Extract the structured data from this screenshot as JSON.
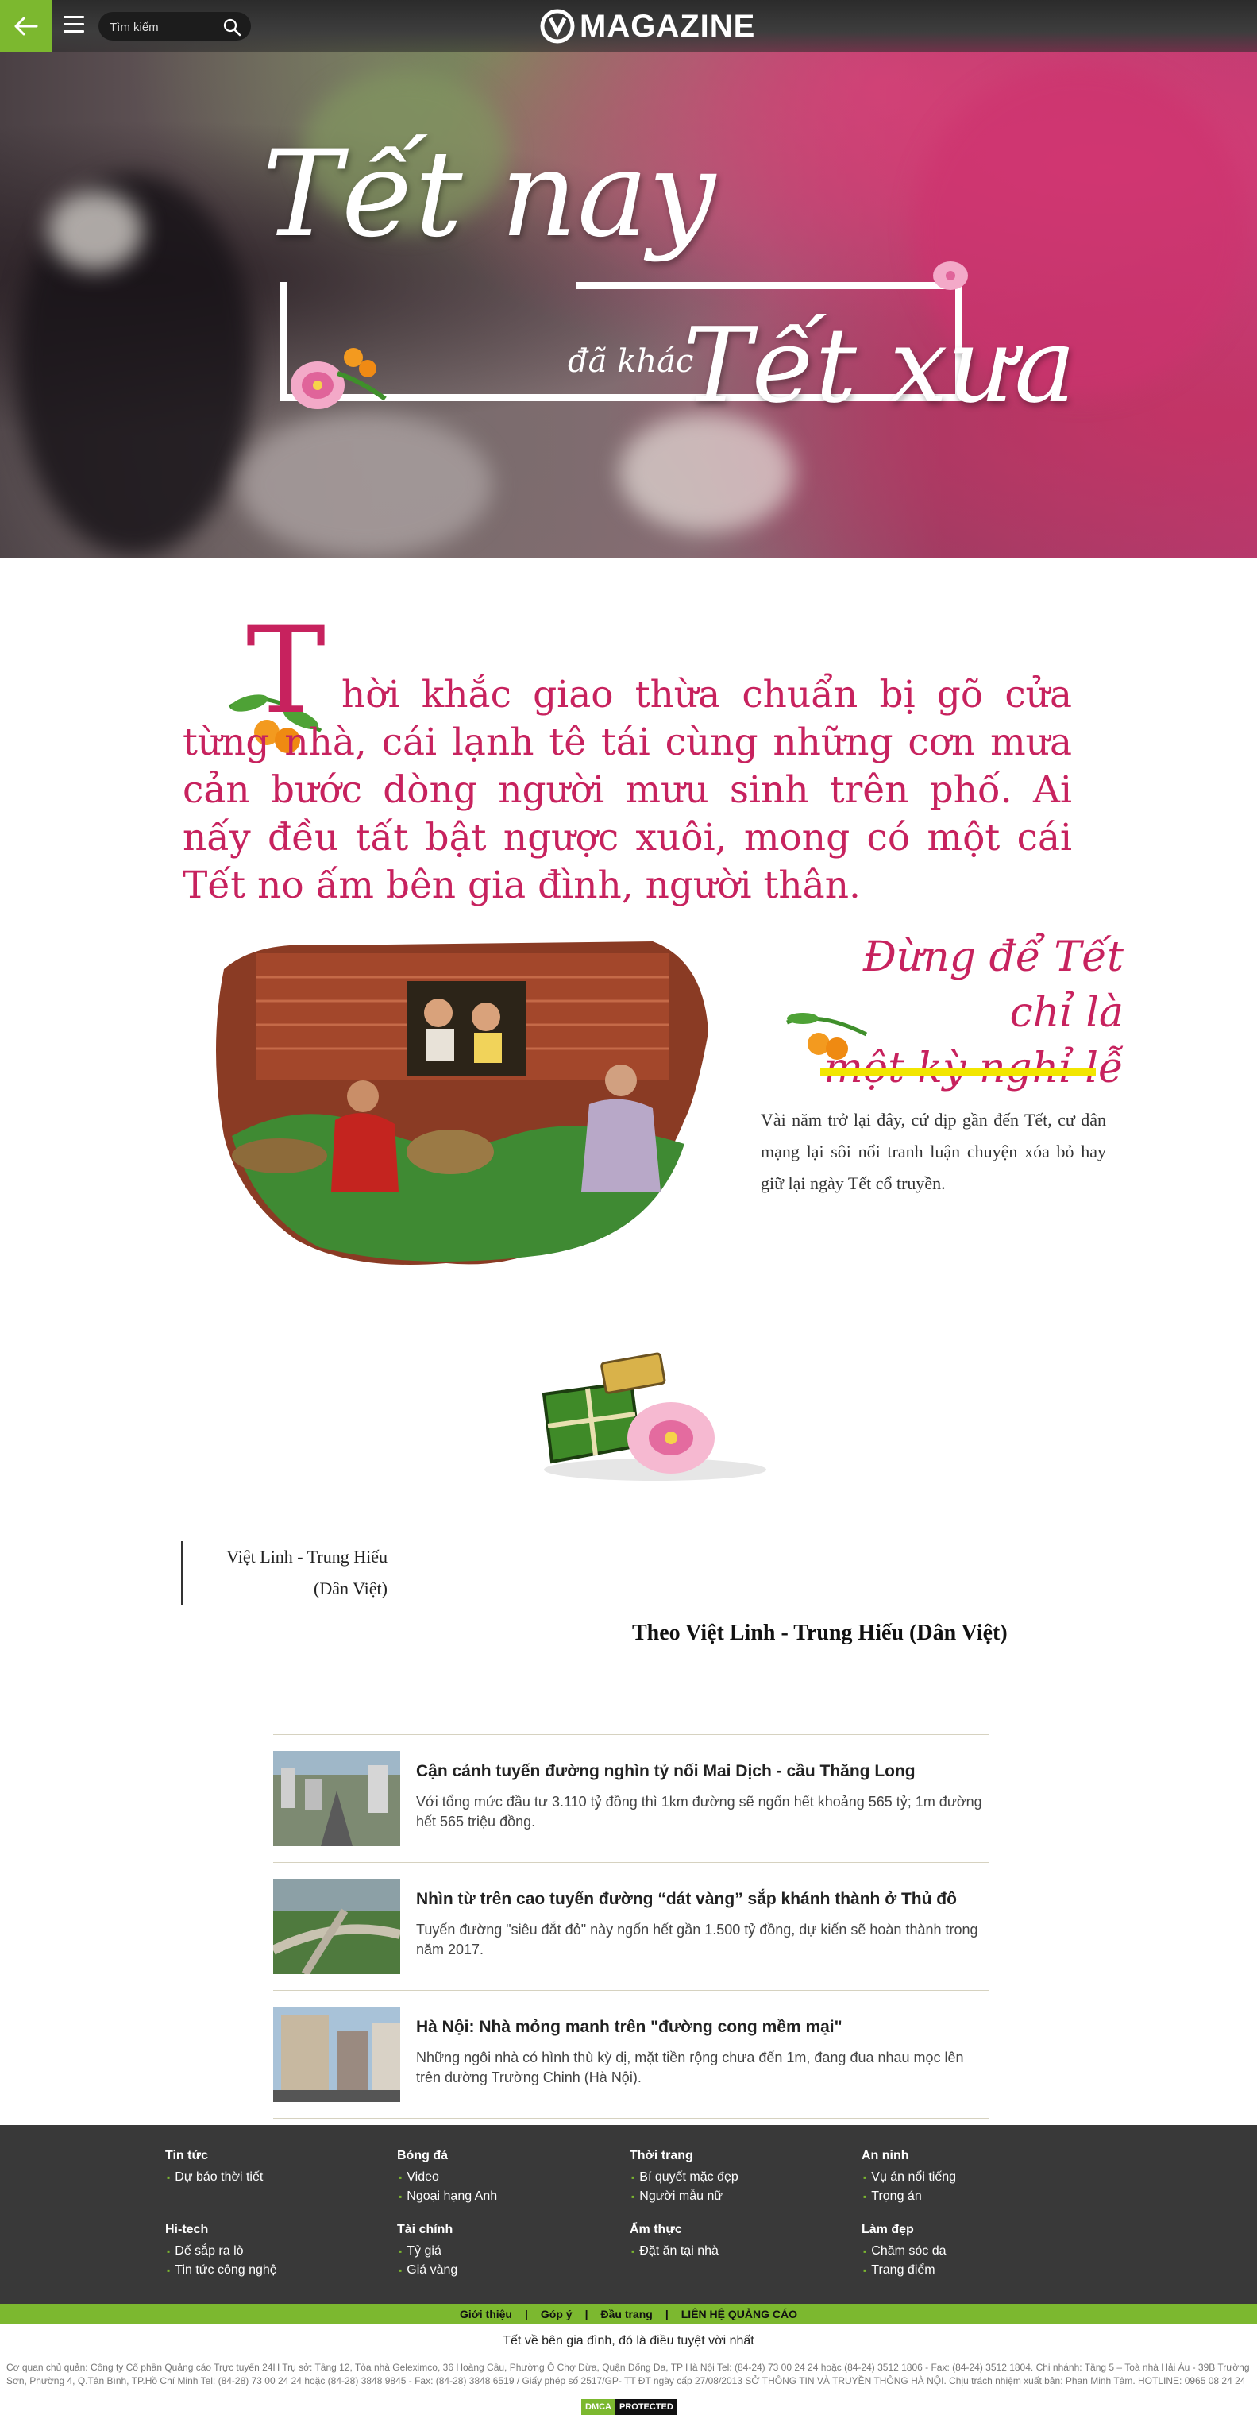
{
  "header": {
    "search_placeholder": "Tìm kiếm",
    "logo_text": "MAGAZINE",
    "accent_color": "#7cb82f"
  },
  "hero": {
    "title_line1": "Tết nay",
    "title_small": "đã khác",
    "title_line2": "Tết xưa"
  },
  "article": {
    "dropcap": "T",
    "lead": "hời khắc giao thừa chuẩn bị gõ cửa từng nhà, cái lạnh tê tái cùng những cơn mưa cản bước dòng người mưu sinh trên phố. Ai nấy đều tất bật ngược xuôi, mong có một cái Tết no ấm bên gia đình, người thân.",
    "quote_line1": "Đừng để Tết chỉ là",
    "quote_line2": "một kỳ nghỉ lễ",
    "intro": "Vài năm trở lại đây, cứ dịp gần đến Tết, cư dân mạng lại sôi nổi tranh luận chuyện xóa bỏ hay giữ lại ngày Tết cổ truyền.",
    "author_line1": "Việt Linh - Trung Hiếu",
    "author_line2": "(Dân Việt)",
    "source": "Theo Việt Linh - Trung Hiếu (Dân Việt)",
    "accent_color": "#c7225e"
  },
  "related": [
    {
      "title": "Cận cảnh tuyến đường nghìn tỷ nối Mai Dịch - cầu Thăng Long",
      "desc": "Với tổng mức đầu tư 3.110 tỷ đồng thì 1km đường sẽ ngốn hết khoảng 565 tỷ; 1m đường hết 565 triệu đồng."
    },
    {
      "title": "Nhìn từ trên cao tuyến đường “dát vàng” sắp khánh thành ở Thủ đô",
      "desc": "Tuyến đường \"siêu đắt đỏ\" này ngốn hết gần 1.500 tỷ đồng, dự kiến sẽ hoàn thành trong năm 2017."
    },
    {
      "title": "Hà Nội: Nhà mỏng manh trên \"đường cong mềm mại\"",
      "desc": "Những ngôi nhà có hình thù kỳ dị, mặt tiền rộng chưa đến 1m, đang đua nhau mọc lên trên đường Trường Chinh (Hà Nội)."
    }
  ],
  "footer": {
    "columns": [
      {
        "title": "Tin tức",
        "links": [
          "Dự báo thời tiết"
        ]
      },
      {
        "title": "Bóng đá",
        "links": [
          "Video",
          "Ngoại hạng Anh"
        ]
      },
      {
        "title": "Thời trang",
        "links": [
          "Bí quyết mặc đẹp",
          "Người mẫu nữ"
        ]
      },
      {
        "title": "An ninh",
        "links": [
          "Vụ án nổi tiếng",
          "Trọng án"
        ]
      },
      {
        "title": "Hi-tech",
        "links": [
          "Dế sắp ra lò",
          "Tin tức công nghệ"
        ]
      },
      {
        "title": "Tài chính",
        "links": [
          "Tỷ giá",
          "Giá vàng"
        ]
      },
      {
        "title": "Ẩm thực",
        "links": [
          "Đặt ăn tại nhà"
        ]
      },
      {
        "title": "Làm đẹp",
        "links": [
          "Chăm sóc da",
          "Trang điểm"
        ]
      }
    ],
    "bar_links": [
      "Giới thiệu",
      "Góp ý",
      "Đầu trang",
      "LIÊN HỆ QUẢNG CÁO"
    ],
    "slogan": "Tết về bên gia đình, đó là điều tuyệt vời nhất",
    "address": "Cơ quan chủ quản: Công ty Cổ phần Quảng cáo Trực tuyến 24H Trụ sở: Tầng 12, Tòa nhà Geleximco, 36 Hoàng Cầu, Phường Ô Chợ Dừa, Quận Đống Đa, TP Hà Nội Tel: (84-24) 73 00 24 24 hoặc (84-24) 3512 1806 - Fax: (84-24) 3512 1804. Chi nhánh: Tầng 5 – Toà nhà Hải Âu - 39B Trường Sơn, Phường 4, Q.Tân Bình, TP.Hồ Chí Minh Tel: (84-28) 73 00 24 24 hoặc (84-28) 3848 9845 - Fax: (84-28) 3848 6519 / Giấy phép số 2517/GP- TT ĐT ngày cấp 27/08/2013 SỞ THÔNG TIN VÀ TRUYỀN THÔNG HÀ NỘI. Chịu trách nhiệm xuất bản: Phan Minh Tâm. HOTLINE: 0965 08 24 24",
    "dmca_left": "DMCA",
    "dmca_right": "PROTECTED"
  }
}
